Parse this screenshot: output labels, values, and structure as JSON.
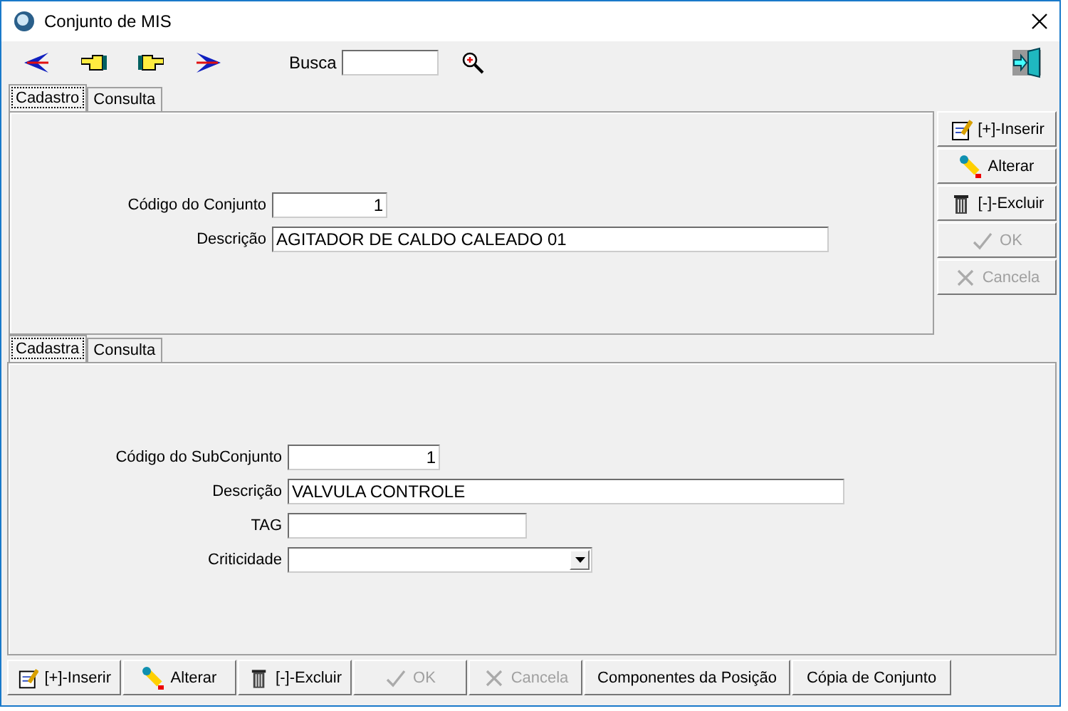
{
  "window": {
    "title": "Conjunto de MIS"
  },
  "toolbar": {
    "search_label": "Busca"
  },
  "tabs": [
    {
      "label": "Cadastro",
      "selected": true
    },
    {
      "label": "Consulta",
      "selected": false
    }
  ],
  "form": {
    "fields": [
      {
        "label": "Código do Conjunto",
        "value": "1",
        "kind": "code"
      },
      {
        "label": "Descrição",
        "value": "AGITADOR DE CALDO CALEADO 01",
        "kind": "text"
      }
    ]
  },
  "side_buttons": [
    {
      "label": "[+]-Inserir",
      "kind": "insert",
      "disabled": false
    },
    {
      "label": "Alterar",
      "kind": "edit",
      "disabled": false
    },
    {
      "label": "[-]-Excluir",
      "kind": "delete",
      "disabled": false
    },
    {
      "label": "OK",
      "kind": "ok",
      "disabled": true
    },
    {
      "label": "Cancela",
      "kind": "cancel",
      "disabled": true
    }
  ],
  "sub_tabs": [
    {
      "label": "Cadastra",
      "selected": true
    },
    {
      "label": "Consulta",
      "selected": false
    }
  ],
  "sub_form": {
    "fields": [
      {
        "label": "Código do SubConjunto",
        "value": "1",
        "kind": "code"
      },
      {
        "label": "Descrição",
        "value": "VALVULA CONTROLE",
        "kind": "text"
      },
      {
        "label": "TAG",
        "kind": "short"
      },
      {
        "label": "Criticidade",
        "kind": "select"
      }
    ]
  },
  "bottom_buttons": [
    {
      "label": "[+]-Inserir",
      "kind": "insert",
      "disabled": false
    },
    {
      "label": "Alterar",
      "kind": "edit",
      "disabled": false
    },
    {
      "label": "[-]-Excluir",
      "kind": "delete",
      "disabled": false
    },
    {
      "label": "OK",
      "kind": "ok",
      "disabled": true
    },
    {
      "label": "Cancela",
      "kind": "cancel",
      "disabled": true
    },
    {
      "label": "Componentes da Posição",
      "kind": "plain",
      "disabled": false
    },
    {
      "label": "Cópia de Conjunto",
      "kind": "plain",
      "disabled": false
    }
  ]
}
